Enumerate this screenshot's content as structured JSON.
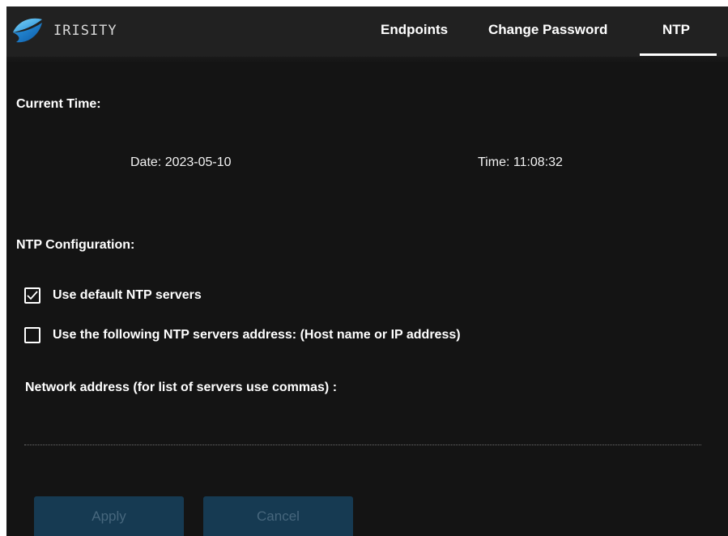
{
  "header": {
    "brand": "IRISITY",
    "tabs": [
      {
        "label": "Endpoints",
        "active": false
      },
      {
        "label": "Change Password",
        "active": false
      },
      {
        "label": "NTP",
        "active": true
      }
    ]
  },
  "current_time": {
    "heading": "Current Time:",
    "date_label": "Date: 2023-05-10",
    "time_label": "Time: 11:08:32"
  },
  "ntp_config": {
    "heading": "NTP Configuration:",
    "options": [
      {
        "label": "Use default NTP servers",
        "checked": true
      },
      {
        "label": "Use the following NTP servers address: (Host name or IP address)",
        "checked": false
      }
    ],
    "address_label": "Network address (for list of servers use commas) :",
    "address_value": ""
  },
  "buttons": {
    "apply": "Apply",
    "cancel": "Cancel"
  },
  "colors": {
    "background": "#141414",
    "header": "#212121",
    "button_bg": "#163a52",
    "button_text": "#47677d"
  }
}
